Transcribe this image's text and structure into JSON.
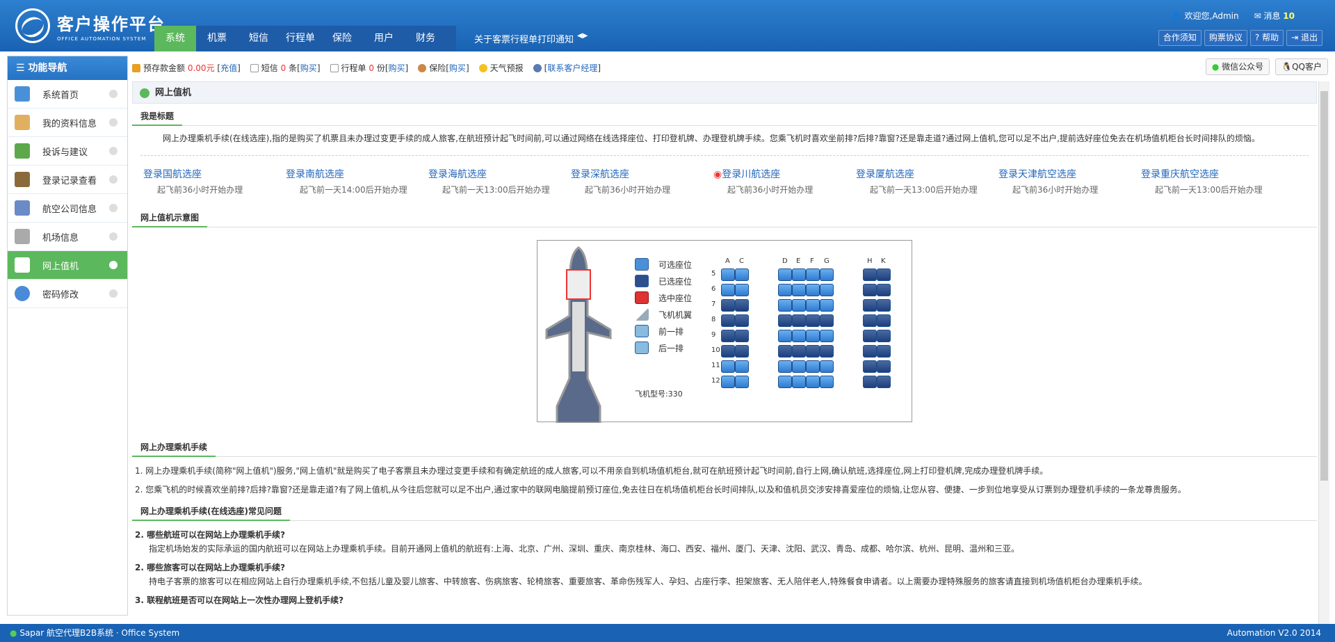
{
  "header": {
    "logo_title": "客户操作平台",
    "logo_sub": "OFFICE AUTOMATION SYSTEM",
    "nav": [
      "系统",
      "机票",
      "短信",
      "行程单",
      "保险",
      "用户",
      "财务"
    ],
    "notice": "关于客票行程单打印通知",
    "welcome": "欢迎您,Admin",
    "messages_label": "消息",
    "messages_count": "10",
    "buttons": [
      "合作须知",
      "购票协议",
      "帮助",
      "退出"
    ]
  },
  "sidebar": {
    "title": "功能导航",
    "items": [
      "系统首页",
      "我的资料信息",
      "投诉与建议",
      "登录记录查看",
      "航空公司信息",
      "机场信息",
      "网上值机",
      "密码修改"
    ]
  },
  "infobar": {
    "deposit_label": "预存款金额",
    "deposit_value": "0.00元",
    "recharge": "充值",
    "sms_label": "短信",
    "sms_count": "0",
    "sms_unit": "条",
    "buy": "购买",
    "itinerary_label": "行程单",
    "itinerary_count": "0",
    "itinerary_unit": "份",
    "insurance_label": "保险",
    "weather": "天气预报",
    "contact": "联系客户经理",
    "wechat": "微信公众号",
    "qq": "QQ客户"
  },
  "main": {
    "panel_title": "网上值机",
    "section1": "我是标题",
    "intro": "网上办理乘机手续(在线选座),指的是购买了机票且未办理过变更手续的成人旅客,在航班预计起飞时间前,可以通过网络在线选择座位、打印登机牌、办理登机牌手续。您乘飞机时喜欢坐前排?后排?靠窗?还是靠走道?通过网上值机,您可以足不出户,提前选好座位免去在机场值机柜台长时间排队的烦恼。",
    "links": [
      {
        "name": "登录国航选座",
        "note": "起飞前36小时开始办理"
      },
      {
        "name": "登录南航选座",
        "note": "起飞前一天14:00后开始办理"
      },
      {
        "name": "登录海航选座",
        "note": "起飞前一天13:00后开始办理"
      },
      {
        "name": "登录深航选座",
        "note": "起飞前36小时开始办理"
      },
      {
        "name": "登录川航选座",
        "note": "起飞前36小时开始办理"
      },
      {
        "name": "登录厦航选座",
        "note": "起飞前一天13:00后开始办理"
      },
      {
        "name": "登录天津航空选座",
        "note": "起飞前36小时开始办理"
      },
      {
        "name": "登录重庆航空选座",
        "note": "起飞前一天13:00后开始办理"
      }
    ],
    "section2": "网上值机示意图",
    "legend": [
      "可选座位",
      "已选座位",
      "选中座位",
      "飞机机翼",
      "前一排",
      "后一排"
    ],
    "plane_type": "飞机型号:330",
    "seat_cols": [
      "A",
      "C",
      "D",
      "E",
      "F",
      "G",
      "H",
      "K"
    ],
    "seat_rows": [
      "5",
      "6",
      "7",
      "8",
      "9",
      "10",
      "11",
      "12"
    ],
    "section3": "网上办理乘机手续",
    "procedures": [
      "1.  网上办理乘机手续(简称\"网上值机\")服务,\"网上值机\"就是购买了电子客票且未办理过变更手续和有确定航班的成人旅客,可以不用亲自到机场值机柜台,就可在航班预计起飞时间前,自行上网,确认航班,选择座位,网上打印登机牌,完成办理登机牌手续。",
      "2.  您乘飞机的时候喜欢坐前排?后排?靠窗?还是靠走道?有了网上值机,从今往后您就可以足不出户,通过家中的联网电脑提前预订座位,免去往日在机场值机柜台长时间排队,以及和值机员交涉安排喜爱座位的烦恼,让您从容、便捷、一步到位地享受从订票到办理登机手续的一条龙尊贵服务。"
    ],
    "section4": "网上办理乘机手续(在线选座)常见问题",
    "faq": [
      {
        "q": "2.  哪些航班可以在网站上办理乘机手续?",
        "a": "指定机场始发的实际承运的国内航班可以在网站上办理乘机手续。目前开通网上值机的航班有:上海、北京、广州、深圳、重庆、南京桂林、海口、西安、福州、厦门、天津、沈阳、武汉、青岛、成都、哈尔滨、杭州、昆明、温州和三亚。"
      },
      {
        "q": "2.  哪些旅客可以在网站上办理乘机手续?",
        "a": "持电子客票的旅客可以在相应网站上自行办理乘机手续,不包括儿童及婴儿旅客、中转旅客、伤病旅客、轮椅旅客、重要旅客、革命伤残军人、孕妇、占座行李、担架旅客、无人陪伴老人,特殊餐食申请者。以上需要办理特殊服务的旅客请直接到机场值机柜台办理乘机手续。"
      },
      {
        "q": "3.  联程航班是否可以在网站上一次性办理网上登机手续?",
        "a": ""
      }
    ]
  },
  "footer": {
    "left": "Sapar 航空代理B2B系统 · Office System",
    "right": "Automation V2.0 2014"
  }
}
